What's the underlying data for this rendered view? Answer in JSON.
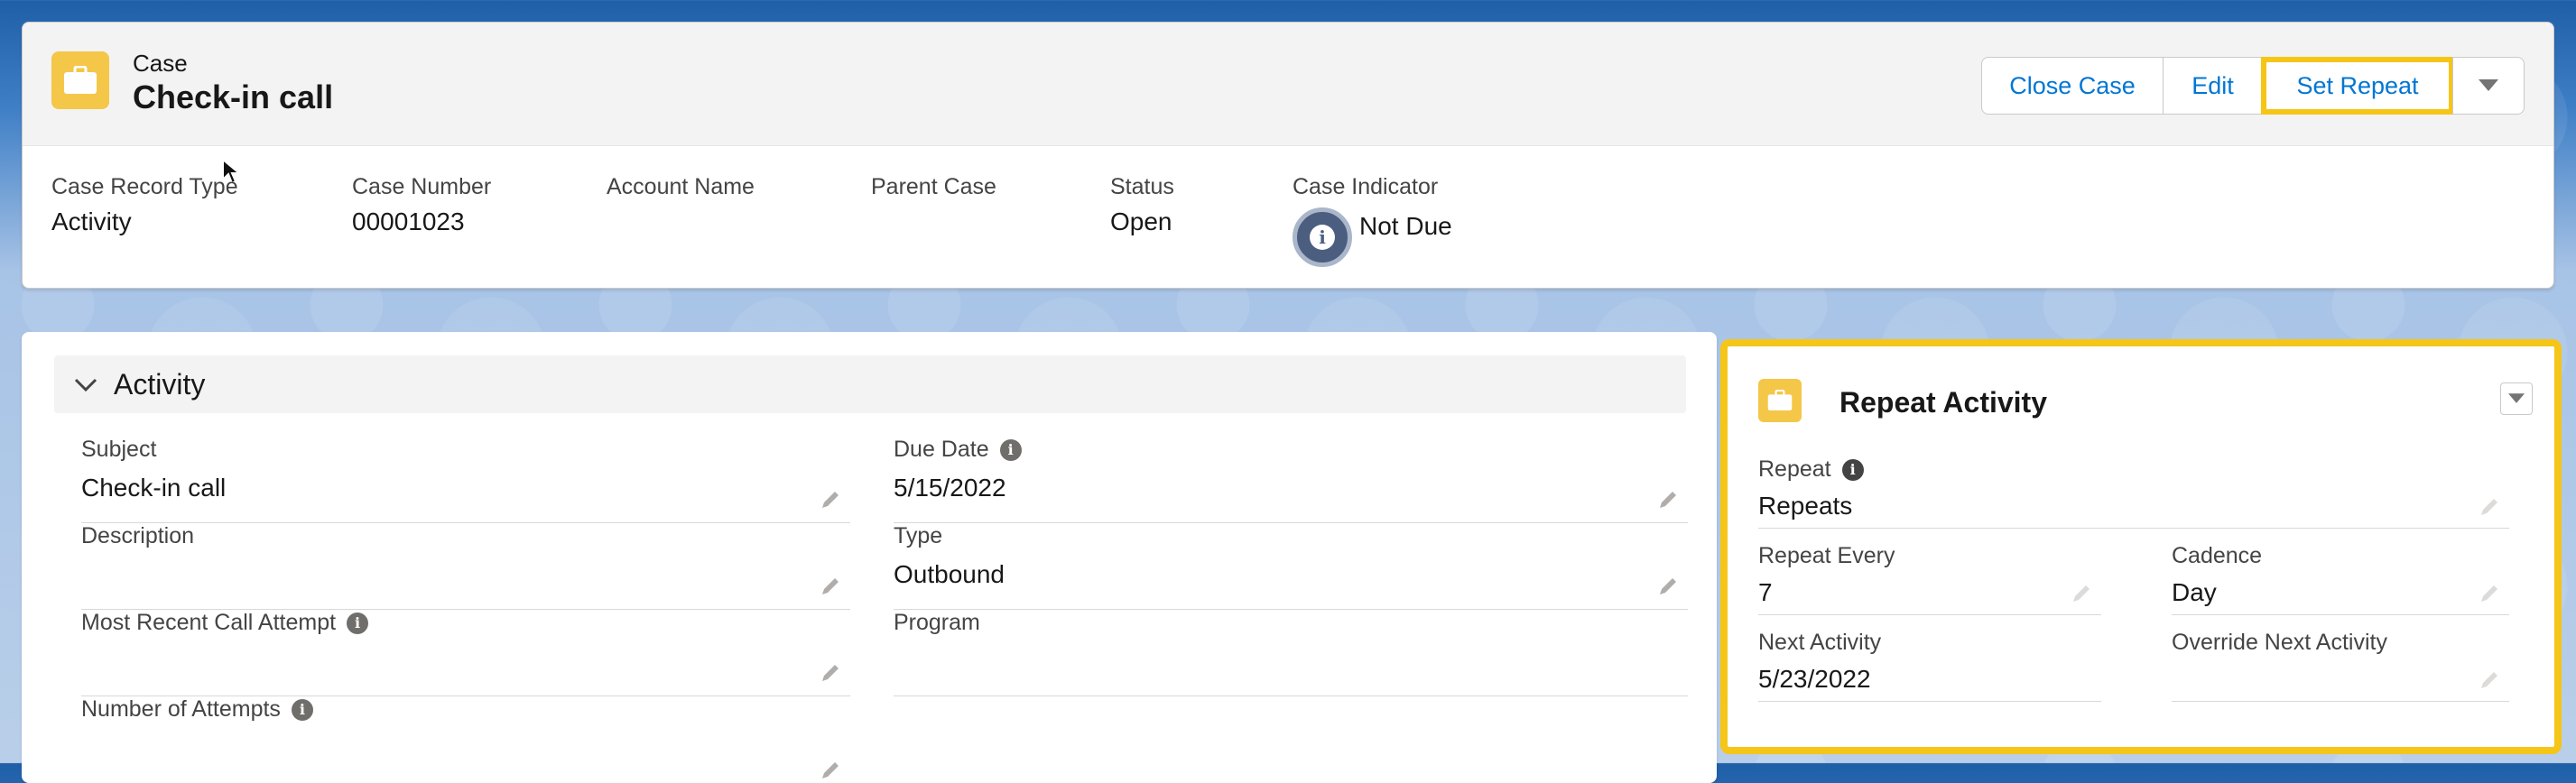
{
  "header": {
    "object_label": "Case",
    "title": "Check-in call",
    "buttons": {
      "close_case": "Close Case",
      "edit": "Edit",
      "set_repeat": "Set Repeat"
    },
    "highlights": [
      {
        "label": "Case Record Type",
        "value": "Activity"
      },
      {
        "label": "Case Number",
        "value": "00001023"
      },
      {
        "label": "Account Name",
        "value": ""
      },
      {
        "label": "Parent Case",
        "value": ""
      },
      {
        "label": "Status",
        "value": "Open"
      },
      {
        "label": "Case Indicator",
        "value": "Not Due"
      }
    ]
  },
  "activity": {
    "section_title": "Activity",
    "left_fields": [
      {
        "label": "Subject",
        "value": "Check-in call"
      },
      {
        "label": "Description",
        "value": ""
      },
      {
        "label": "Most Recent Call Attempt",
        "value": ""
      },
      {
        "label": "Number of Attempts",
        "value": ""
      }
    ],
    "right_fields": [
      {
        "label": "Due Date",
        "value": "5/15/2022"
      },
      {
        "label": "Type",
        "value": "Outbound"
      },
      {
        "label": "Program",
        "value": ""
      }
    ]
  },
  "repeat_activity": {
    "title": "Repeat Activity",
    "fields": [
      {
        "label": "Repeat",
        "value": "Repeats"
      },
      {
        "label": "Repeat Every",
        "value": "7"
      },
      {
        "label": "Cadence",
        "value": "Day"
      },
      {
        "label": "Next Activity",
        "value": "5/23/2022"
      },
      {
        "label": "Override Next Activity",
        "value": ""
      }
    ]
  },
  "colors": {
    "brand_blue": "#0176d3",
    "highlight_yellow": "#f5c518",
    "case_icon": "#f4c748",
    "indicator": "#4b5e80"
  },
  "icons": [
    "briefcase-icon",
    "chevron-down-icon",
    "info-icon",
    "pencil-icon",
    "dropdown-arrow-icon",
    "mouse-cursor-icon"
  ]
}
